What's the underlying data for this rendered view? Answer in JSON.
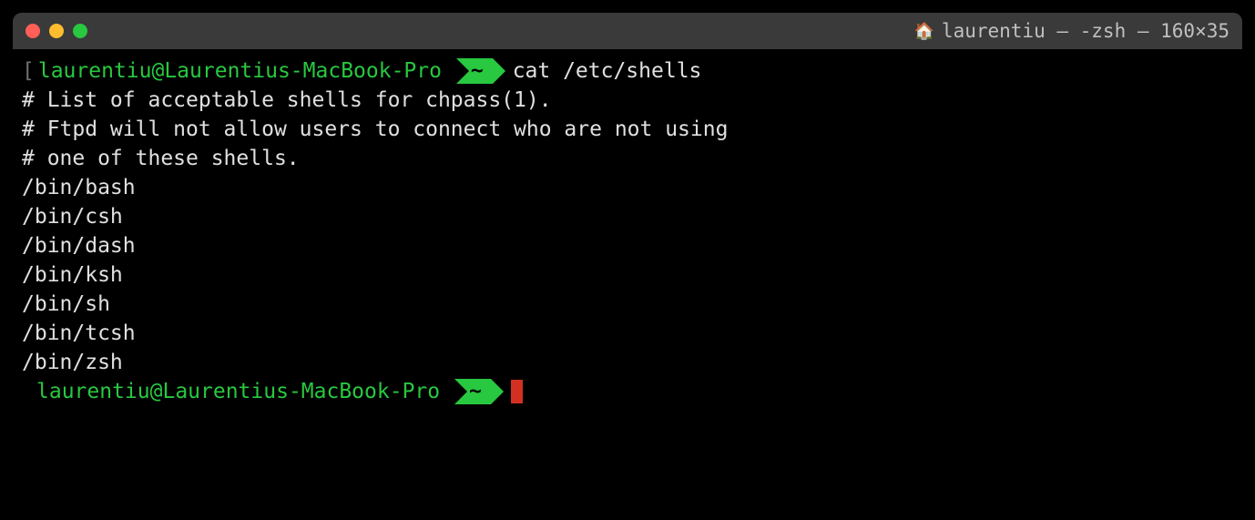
{
  "title_bar": {
    "title": "laurentiu — -zsh — 160×35"
  },
  "terminal": {
    "prompt_user": "laurentiu@Laurentius-MacBook-Pro",
    "prompt_dir": "~",
    "command": "cat /etc/shells",
    "output_lines": [
      "# List of acceptable shells for chpass(1).",
      "# Ftpd will not allow users to connect who are not using",
      "# one of these shells.",
      "",
      "/bin/bash",
      "/bin/csh",
      "/bin/dash",
      "/bin/ksh",
      "/bin/sh",
      "/bin/tcsh",
      "/bin/zsh"
    ]
  }
}
